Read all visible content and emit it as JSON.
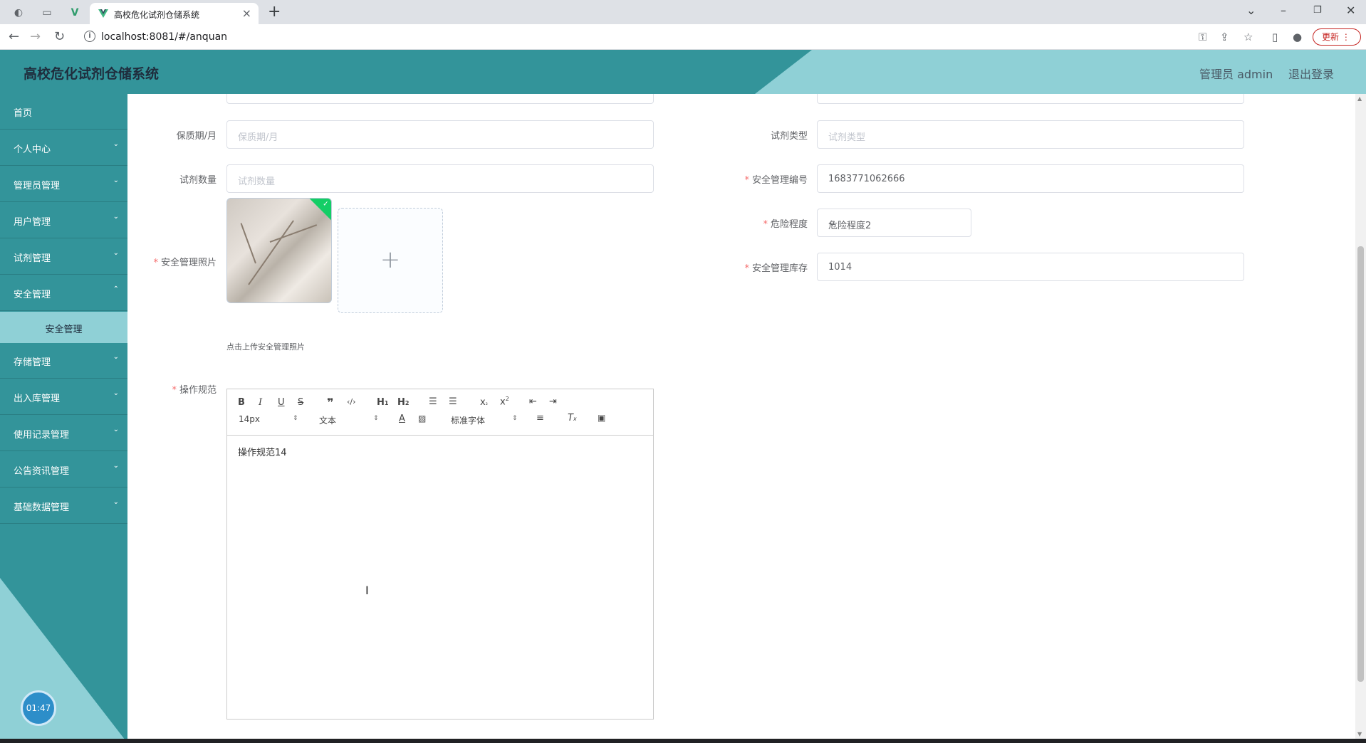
{
  "browser": {
    "tab_title": "高校危化试剂仓储系统",
    "url": "localhost:8081/#/anquan",
    "update_label": "更新"
  },
  "header": {
    "title": "高校危化试剂仓储系统",
    "user_label": "管理员 admin",
    "logout_label": "退出登录"
  },
  "sidebar": {
    "items": [
      {
        "label": "首页"
      },
      {
        "label": "个人中心"
      },
      {
        "label": "管理员管理"
      },
      {
        "label": "用户管理"
      },
      {
        "label": "试剂管理"
      },
      {
        "label": "安全管理"
      },
      {
        "label": "存储管理"
      },
      {
        "label": "出入库管理"
      },
      {
        "label": "使用记录管理"
      },
      {
        "label": "公告资讯管理"
      },
      {
        "label": "基础数据管理"
      }
    ],
    "active_sub": "安全管理",
    "timer": "01:47"
  },
  "form": {
    "shelf_life": {
      "label": "保质期/月",
      "placeholder": "保质期/月"
    },
    "reagent_type": {
      "label": "试剂类型",
      "placeholder": "试剂类型"
    },
    "quantity": {
      "label": "试剂数量",
      "placeholder": "试剂数量"
    },
    "safety_no": {
      "label": "安全管理编号",
      "value": "1683771062666"
    },
    "danger_level": {
      "label": "危险程度",
      "value": "危险程度2"
    },
    "photo": {
      "label": "安全管理照片",
      "tip": "点击上传安全管理照片"
    },
    "stock": {
      "label": "安全管理库存",
      "value": "1014"
    },
    "rules": {
      "label": "操作规范",
      "content": "操作规范14"
    }
  },
  "editor": {
    "size": "14px",
    "header_picker": "文本",
    "font_picker": "标准字体"
  }
}
